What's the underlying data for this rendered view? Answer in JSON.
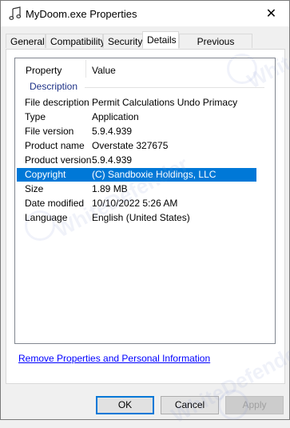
{
  "window": {
    "title": "MyDoom.exe Properties",
    "close_glyph": "✕",
    "icon": "music-note-icon"
  },
  "tabs": [
    {
      "label": "General"
    },
    {
      "label": "Compatibility"
    },
    {
      "label": "Security"
    },
    {
      "label": "Details",
      "active": true
    },
    {
      "label": "Previous Versions"
    }
  ],
  "details": {
    "columns": {
      "property": "Property",
      "value": "Value"
    },
    "group": "Description",
    "rows": [
      {
        "property": "File description",
        "value": "Permit Calculations Undo Primacy"
      },
      {
        "property": "Type",
        "value": "Application"
      },
      {
        "property": "File version",
        "value": "5.9.4.939"
      },
      {
        "property": "Product name",
        "value": "Overstate 327675"
      },
      {
        "property": "Product version",
        "value": "5.9.4.939"
      },
      {
        "property": "Copyright",
        "value": "(C) Sandboxie Holdings, LLC",
        "selected": true
      },
      {
        "property": "Size",
        "value": "1.89 MB"
      },
      {
        "property": "Date modified",
        "value": "10/10/2022 5:26 AM"
      },
      {
        "property": "Language",
        "value": "English (United States)"
      }
    ]
  },
  "link": "Remove Properties and Personal Information",
  "buttons": {
    "ok": "OK",
    "cancel": "Cancel",
    "apply": "Apply"
  },
  "watermark": {
    "text": "WhiteDefender"
  },
  "colors": {
    "selection": "#0078d7",
    "group_header": "#1e3287",
    "link": "#0000ff"
  }
}
